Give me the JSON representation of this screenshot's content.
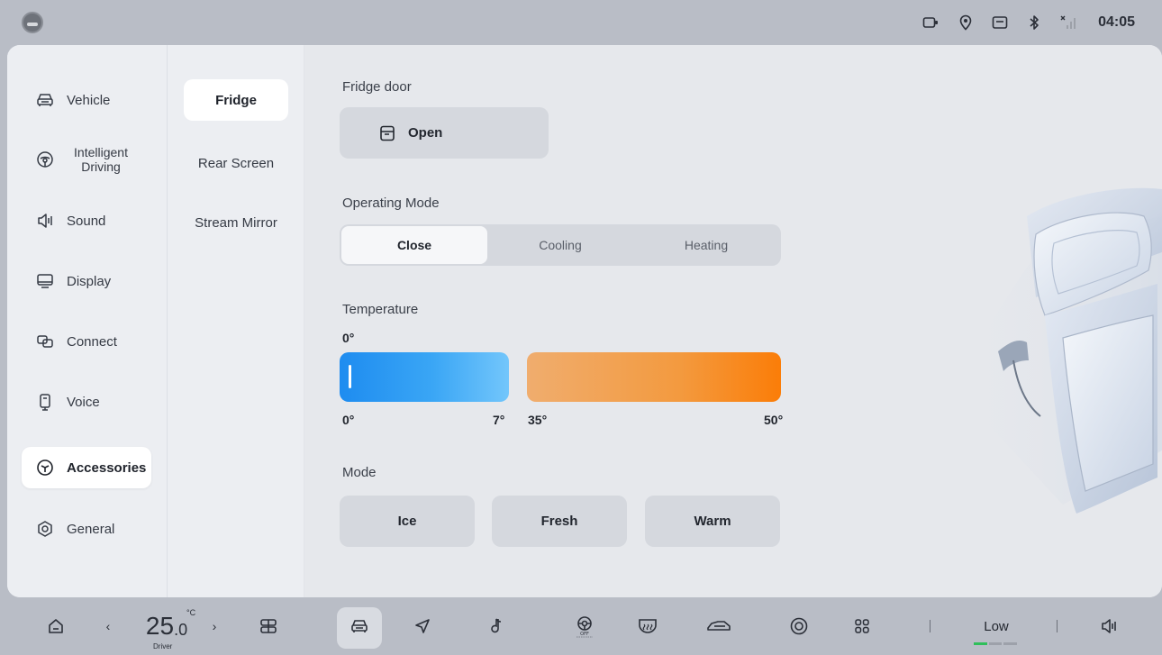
{
  "status": {
    "time": "04:05",
    "icons": [
      "dashcam-icon",
      "location-icon",
      "message-icon",
      "bluetooth-icon",
      "no-signal-icon"
    ]
  },
  "nav": {
    "items": [
      {
        "label": "Vehicle",
        "icon": "car-icon"
      },
      {
        "label": "Intelligent Driving",
        "icon": "steering-wheel-icon"
      },
      {
        "label": "Sound",
        "icon": "speaker-icon"
      },
      {
        "label": "Display",
        "icon": "monitor-icon"
      },
      {
        "label": "Connect",
        "icon": "link-icon"
      },
      {
        "label": "Voice",
        "icon": "phone-icon"
      },
      {
        "label": "Accessories",
        "icon": "cube-icon",
        "active": true
      },
      {
        "label": "General",
        "icon": "settings-icon"
      }
    ]
  },
  "subnav": {
    "items": [
      {
        "label": "Fridge",
        "active": true
      },
      {
        "label": "Rear Screen"
      },
      {
        "label": "Stream Mirror"
      }
    ]
  },
  "fridge": {
    "door_label": "Fridge door",
    "door_button": "Open",
    "mode_label": "Operating Mode",
    "operating_modes": [
      "Close",
      "Cooling",
      "Heating"
    ],
    "operating_mode_selected": "Close",
    "temperature_label": "Temperature",
    "temperature_current": "0°",
    "cold_range": {
      "min": "0°",
      "max": "7°"
    },
    "hot_range": {
      "min": "35°",
      "max": "50°"
    },
    "cold_level": 0,
    "section_mode_label": "Mode",
    "modes": [
      "Ice",
      "Fresh",
      "Warm"
    ]
  },
  "dock": {
    "temp_int": "25",
    "temp_dec": ".0",
    "temp_unit": "°C",
    "zone": "Driver",
    "fan": "Low",
    "fan_level_fraction": 0.33,
    "icons": [
      "home-icon",
      "climate-panel-icon",
      "car-icon",
      "navigation-icon",
      "music-icon",
      "steering-heat-off-icon",
      "rear-defrost-icon",
      "car-side-icon",
      "camera-360-icon",
      "apps-icon",
      "volume-icon"
    ]
  },
  "colors": {
    "cold_start": "#1e8cf0",
    "cold_end": "#73c6fb",
    "hot_start": "#f0ad6e",
    "hot_end": "#fb7d08",
    "fan_active": "#2fbf5a"
  }
}
